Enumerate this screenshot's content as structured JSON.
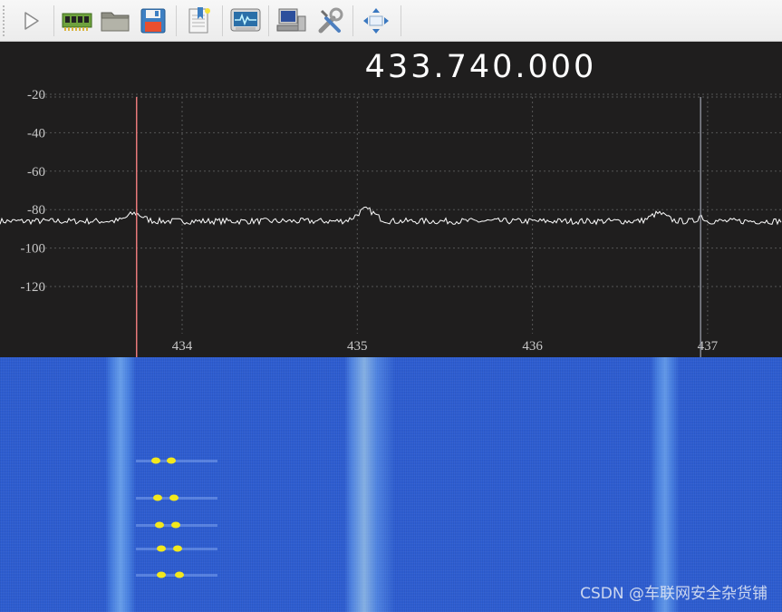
{
  "toolbar": {
    "buttons": [
      {
        "name": "play-button",
        "icon": "play-icon"
      },
      {
        "name": "input-device-button",
        "icon": "circuit-board-icon"
      },
      {
        "name": "open-button",
        "icon": "folder-icon"
      },
      {
        "name": "save-button",
        "icon": "floppy-disk-icon"
      },
      {
        "name": "bookmarks-button",
        "icon": "bookmark-icon"
      },
      {
        "name": "fft-settings-button",
        "icon": "monitor-waveform-icon"
      },
      {
        "name": "remote-control-button",
        "icon": "networked-computer-icon"
      },
      {
        "name": "settings-button",
        "icon": "tools-icon"
      },
      {
        "name": "fullscreen-button",
        "icon": "move-arrows-icon"
      }
    ]
  },
  "frequency_display": "433.740.000",
  "fft": {
    "y_ticks": [
      "-20",
      "-40",
      "-60",
      "-80",
      "-100",
      "-120"
    ],
    "x_ticks": [
      "434",
      "435",
      "436",
      "437"
    ],
    "y_range": [
      -130,
      -10
    ],
    "x_range_mhz": [
      433.29,
      437.43
    ],
    "demod_marker_mhz": 433.74,
    "secondary_marker_mhz": 436.96,
    "trace_color": "#ffffff",
    "marker_color": "#e8797a",
    "grid_color": "#555555"
  },
  "waterfall": {
    "background_color": "#2f5fd3",
    "burst_color": "#f3e81c"
  },
  "watermark": "CSDN @车联网安全杂货铺"
}
